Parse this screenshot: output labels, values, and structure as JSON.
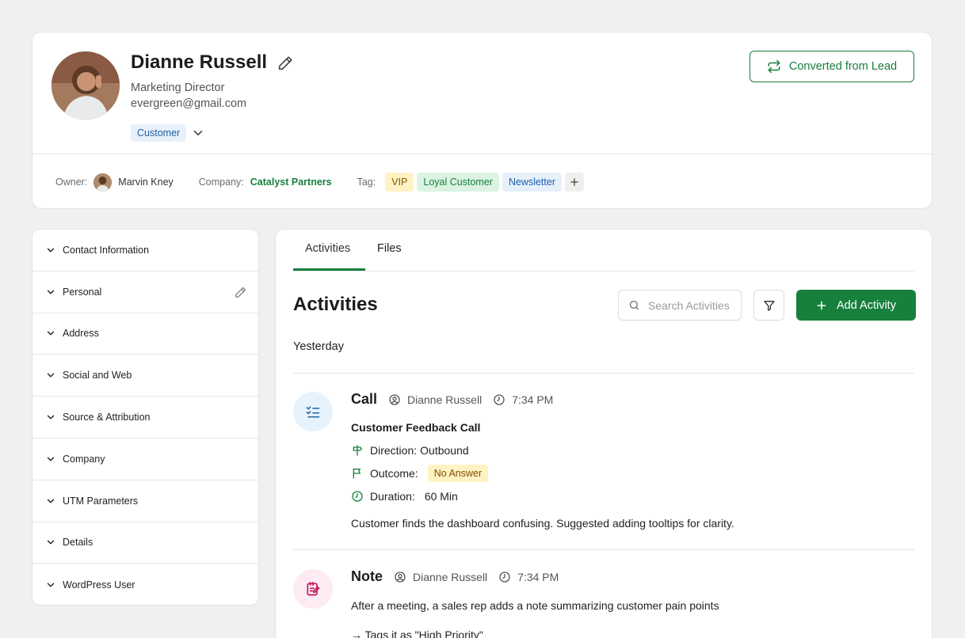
{
  "contact": {
    "name": "Dianne Russell",
    "title": "Marketing Director",
    "email": "evergreen@gmail.com",
    "stage": "Customer",
    "converted_label": "Converted from Lead"
  },
  "meta": {
    "owner_label": "Owner:",
    "owner_name": "Marvin Kney",
    "company_label": "Company:",
    "company_name": "Catalyst Partners",
    "tag_label": "Tag:",
    "tags": [
      "VIP",
      "Loyal Customer",
      "Newsletter"
    ]
  },
  "sidebar": {
    "sections": [
      "Contact Information",
      "Personal",
      "Address",
      "Social and Web",
      "Source & Attribution",
      "Company",
      "UTM Parameters",
      "Details",
      "WordPress User"
    ]
  },
  "tabs": [
    "Activities",
    "Files"
  ],
  "activities_panel": {
    "title": "Activities",
    "search_placeholder": "Search Activities",
    "add_label": "Add Activity",
    "day_label": "Yesterday",
    "items": [
      {
        "type": "Call",
        "user": "Dianne Russell",
        "time": "7:34 PM",
        "subject": "Customer Feedback Call",
        "direction_label": "Direction:",
        "direction_value": "Outbound",
        "outcome_label": "Outcome:",
        "outcome_value": "No Answer",
        "duration_label": "Duration:",
        "duration_value": "60 Min",
        "description": "Customer finds the dashboard confusing. Suggested adding tooltips for clarity."
      },
      {
        "type": "Note",
        "user": "Dianne Russell",
        "time": "7:34 PM",
        "description": "After a meeting, a sales rep adds a note summarizing customer pain points",
        "line2": "→ Tags it as \"High Priority\""
      }
    ]
  },
  "colors": {
    "brand_green": "#17803d",
    "blue_badge": "#e8f1fb",
    "yellow_badge": "#fdf3c3"
  }
}
